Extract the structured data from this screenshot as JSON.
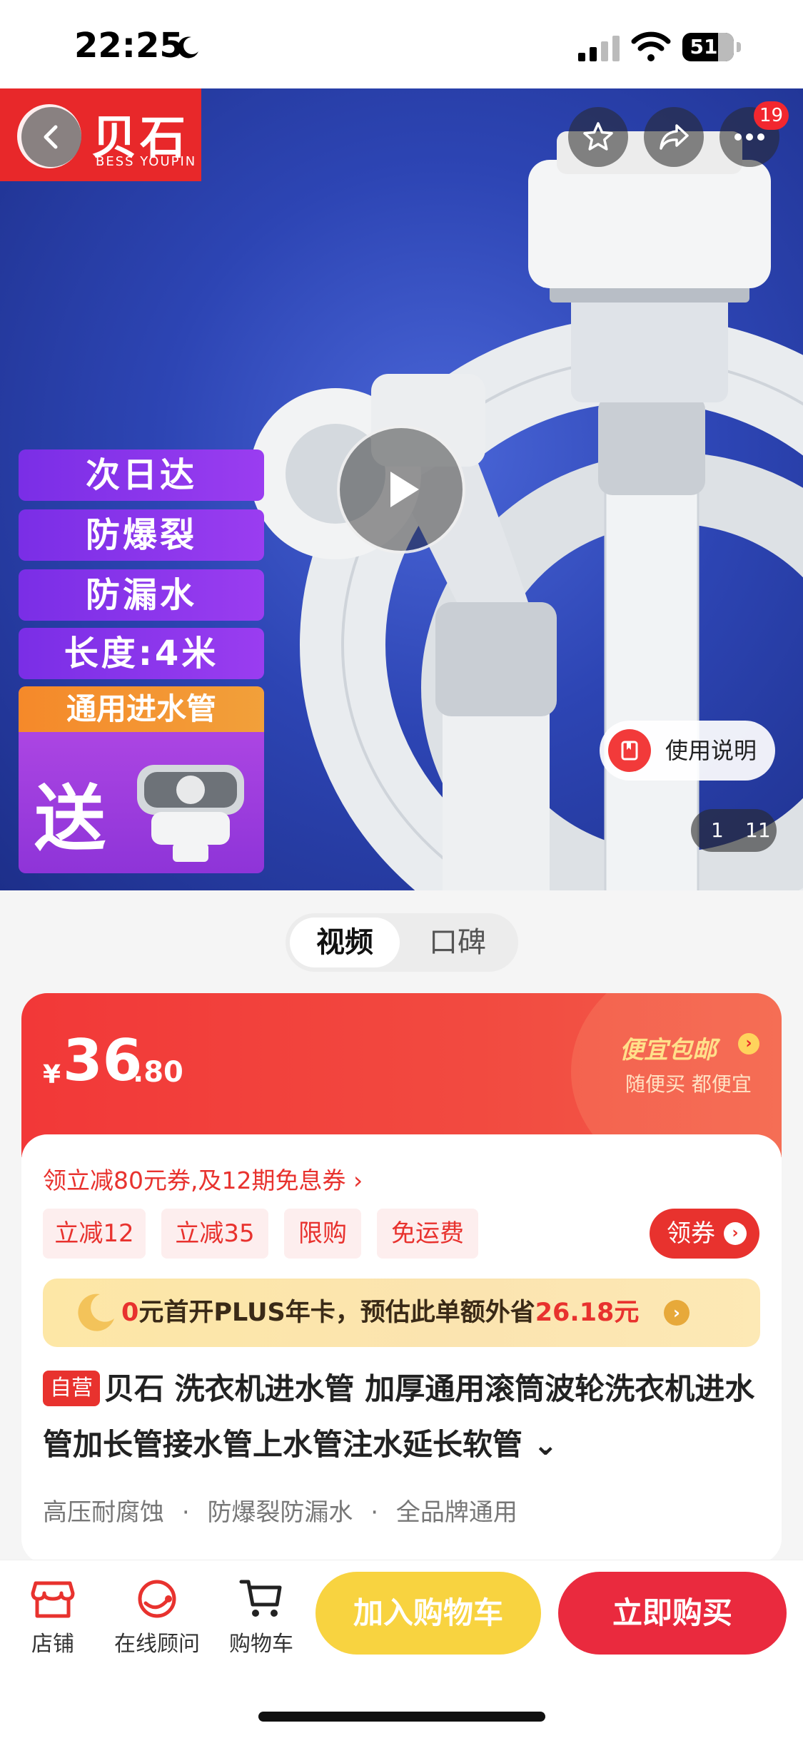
{
  "status": {
    "time": "22:25",
    "battery": "51"
  },
  "hero": {
    "brand_name": "贝石",
    "brand_sub": "BESS YOUPIN",
    "more_badge": "19",
    "features": [
      "次日达",
      "防爆裂",
      "防漏水",
      "长度:4米"
    ],
    "gift_head": "通用进水管",
    "gift_word": "送",
    "manual_label": "使用说明",
    "page_current": "1",
    "page_total": "11"
  },
  "media_tabs": {
    "video": "视频",
    "review": "口碑"
  },
  "price": {
    "currency": "¥",
    "integer": "36",
    "decimal": ".80",
    "promo_title": "便宜包邮",
    "promo_sub": "随便买 都便宜"
  },
  "coupon_line": "领立减80元券,及12期免息券 ›",
  "chips": [
    "立减12",
    "立减35",
    "限购",
    "免运费"
  ],
  "claim_label": "领券",
  "plus": {
    "lead": "0元首开PLUS年卡，预估此单额外省",
    "amount": "26.18元"
  },
  "product": {
    "badge": "自营",
    "title": "贝石 洗衣机进水管 加厚通用滚筒波轮洗衣机进水管加长管接水管上水管注水延长软管 ⌄",
    "specs": [
      "高压耐腐蚀",
      "防爆裂防漏水",
      "全品牌通用"
    ]
  },
  "bottom_bar": {
    "shop": "店铺",
    "service": "在线顾问",
    "cart": "购物车",
    "add_cart": "加入购物车",
    "buy_now": "立即购买"
  },
  "colors": {
    "accent": "#e8322e",
    "hero_bg": "#2d45b4",
    "add_cart": "#f8d340",
    "buy": "#ea2a3e"
  }
}
